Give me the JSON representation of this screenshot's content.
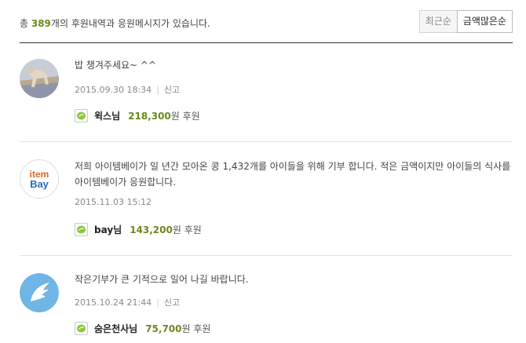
{
  "summary": {
    "prefix": "총 ",
    "count": "389",
    "suffix": "개의 후원내역과 응원메시지가 있습니다."
  },
  "sort": {
    "recent": "최근순",
    "amount": "금액많은순"
  },
  "colors": {
    "accent": "#6a8a1a",
    "bean": "#8dc63f"
  },
  "report_label": "신고",
  "amount_suffix": "원 후원",
  "entries": [
    {
      "avatar_icon": "dog-photo-avatar",
      "message": "밥 챙겨주세요~ ^^",
      "date": "2015.09.30 18:34",
      "name": "윅스님",
      "amount": "218,300"
    },
    {
      "avatar_icon": "itembay-logo-avatar",
      "avatar_text_1": "item",
      "avatar_text_2": "Bay",
      "message": "저희 아이템베이가 일 년간 모아온 콩 1,432개를 아이들을 위해 기부 합니다. 적은 금액이지만 아이들의 식사를 아이템베이가 응원합니다.",
      "date": "2015.11.03 15:12",
      "name": "bay님",
      "amount": "143,200"
    },
    {
      "avatar_icon": "angel-wing-avatar",
      "message": "작은기부가 큰 기적으로 일어 나길 바랍니다.",
      "date": "2015.10.24 21:44",
      "name": "숨은천사님",
      "amount": "75,700"
    }
  ]
}
